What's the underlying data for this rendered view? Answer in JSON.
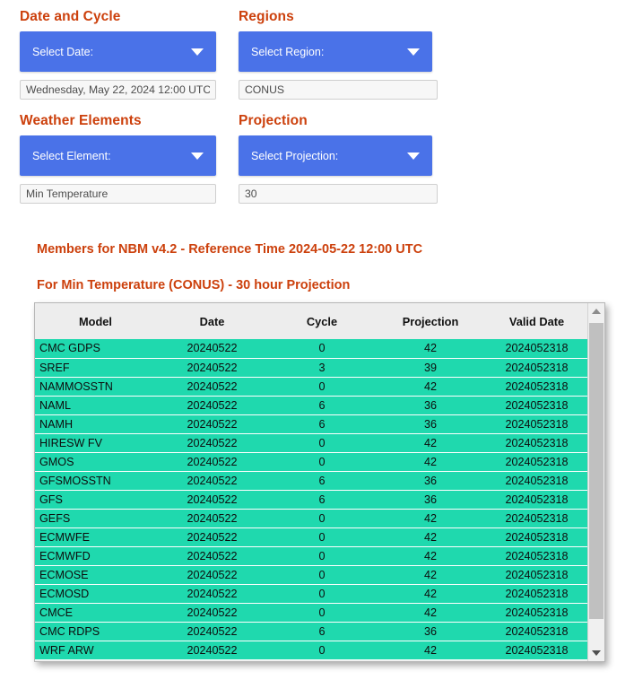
{
  "colors": {
    "accent_orange": "#cc400c",
    "dropdown_blue": "#4a72e8",
    "row_teal": "#1fd9ae",
    "header_gray": "#ededed"
  },
  "controls": {
    "date_and_cycle": {
      "title": "Date and Cycle",
      "dropdown_label": "Select Date:",
      "value": "Wednesday, May 22, 2024 12:00 UTC",
      "placeholder": "Select Date:"
    },
    "regions": {
      "title": "Regions",
      "dropdown_label": "Select Region:",
      "value": "CONUS",
      "placeholder": "Select Region:"
    },
    "weather_elements": {
      "title": "Weather Elements",
      "dropdown_label": "Select Element:",
      "value": "Min Temperature",
      "placeholder": "Select Element:"
    },
    "projection": {
      "title": "Projection",
      "dropdown_label": "Select Projection:",
      "value": "30",
      "placeholder": "Select Projection:"
    }
  },
  "report": {
    "heading_main": "Members for NBM v4.2 - Reference Time 2024-05-22 12:00 UTC",
    "heading_sub": "For Min Temperature (CONUS) - 30 hour Projection"
  },
  "table": {
    "columns": [
      "Model",
      "Date",
      "Cycle",
      "Projection",
      "Valid Date"
    ],
    "rows": [
      {
        "model": "CMC GDPS",
        "date": "20240522",
        "cycle": "0",
        "projection": "42",
        "valid_date": "2024052318"
      },
      {
        "model": "SREF",
        "date": "20240522",
        "cycle": "3",
        "projection": "39",
        "valid_date": "2024052318"
      },
      {
        "model": "NAMMOSSTN",
        "date": "20240522",
        "cycle": "0",
        "projection": "42",
        "valid_date": "2024052318"
      },
      {
        "model": "NAML",
        "date": "20240522",
        "cycle": "6",
        "projection": "36",
        "valid_date": "2024052318"
      },
      {
        "model": "NAMH",
        "date": "20240522",
        "cycle": "6",
        "projection": "36",
        "valid_date": "2024052318"
      },
      {
        "model": "HIRESW FV",
        "date": "20240522",
        "cycle": "0",
        "projection": "42",
        "valid_date": "2024052318"
      },
      {
        "model": "GMOS",
        "date": "20240522",
        "cycle": "0",
        "projection": "42",
        "valid_date": "2024052318"
      },
      {
        "model": "GFSMOSSTN",
        "date": "20240522",
        "cycle": "6",
        "projection": "36",
        "valid_date": "2024052318"
      },
      {
        "model": "GFS",
        "date": "20240522",
        "cycle": "6",
        "projection": "36",
        "valid_date": "2024052318"
      },
      {
        "model": "GEFS",
        "date": "20240522",
        "cycle": "0",
        "projection": "42",
        "valid_date": "2024052318"
      },
      {
        "model": "ECMWFE",
        "date": "20240522",
        "cycle": "0",
        "projection": "42",
        "valid_date": "2024052318"
      },
      {
        "model": "ECMWFD",
        "date": "20240522",
        "cycle": "0",
        "projection": "42",
        "valid_date": "2024052318"
      },
      {
        "model": "ECMOSE",
        "date": "20240522",
        "cycle": "0",
        "projection": "42",
        "valid_date": "2024052318"
      },
      {
        "model": "ECMOSD",
        "date": "20240522",
        "cycle": "0",
        "projection": "42",
        "valid_date": "2024052318"
      },
      {
        "model": "CMCE",
        "date": "20240522",
        "cycle": "0",
        "projection": "42",
        "valid_date": "2024052318"
      },
      {
        "model": "CMC RDPS",
        "date": "20240522",
        "cycle": "6",
        "projection": "36",
        "valid_date": "2024052318"
      },
      {
        "model": "WRF ARW",
        "date": "20240522",
        "cycle": "0",
        "projection": "42",
        "valid_date": "2024052318"
      }
    ]
  },
  "scrollbar": {
    "up_arrow": "scroll-up",
    "down_arrow": "scroll-down"
  }
}
